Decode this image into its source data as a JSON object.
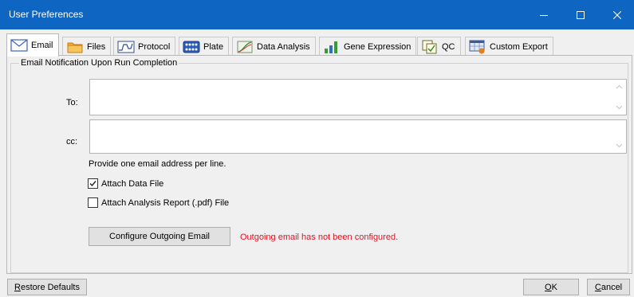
{
  "window": {
    "title": "User Preferences",
    "controls": [
      "minimize",
      "maximize",
      "close"
    ]
  },
  "tabs": [
    {
      "label": "Email",
      "icon": "envelope-icon",
      "active": true
    },
    {
      "label": "Files",
      "icon": "folder-icon",
      "active": false
    },
    {
      "label": "Protocol",
      "icon": "protocol-graph-icon",
      "active": false
    },
    {
      "label": "Plate",
      "icon": "plate-icon",
      "active": false
    },
    {
      "label": "Data Analysis",
      "icon": "analysis-curve-icon",
      "active": false
    },
    {
      "label": "Gene Expression",
      "icon": "bar-chart-icon",
      "active": false
    },
    {
      "label": "QC",
      "icon": "qc-checklist-icon",
      "active": false
    },
    {
      "label": "Custom Export",
      "icon": "export-table-icon",
      "active": false
    }
  ],
  "email": {
    "group_title": "Email Notification Upon Run Completion",
    "to_label": "To:",
    "to_value": "",
    "cc_label": "cc:",
    "cc_value": "",
    "hint": "Provide one email address per line.",
    "attach_data_label": "Attach Data File",
    "attach_data_checked": true,
    "attach_report_label": "Attach Analysis Report (.pdf) File",
    "attach_report_checked": false,
    "configure_button": "Configure Outgoing Email",
    "status_message": "Outgoing email has not been configured.",
    "status_color": "#e81123"
  },
  "footer": {
    "restore_first": "R",
    "restore_rest": "estore Defaults",
    "ok_first": "O",
    "ok_rest": "K",
    "cancel_first": "C",
    "cancel_rest": "ancel"
  },
  "colors": {
    "titlebar": "#0f65c2",
    "accent": "#0f65c2"
  }
}
